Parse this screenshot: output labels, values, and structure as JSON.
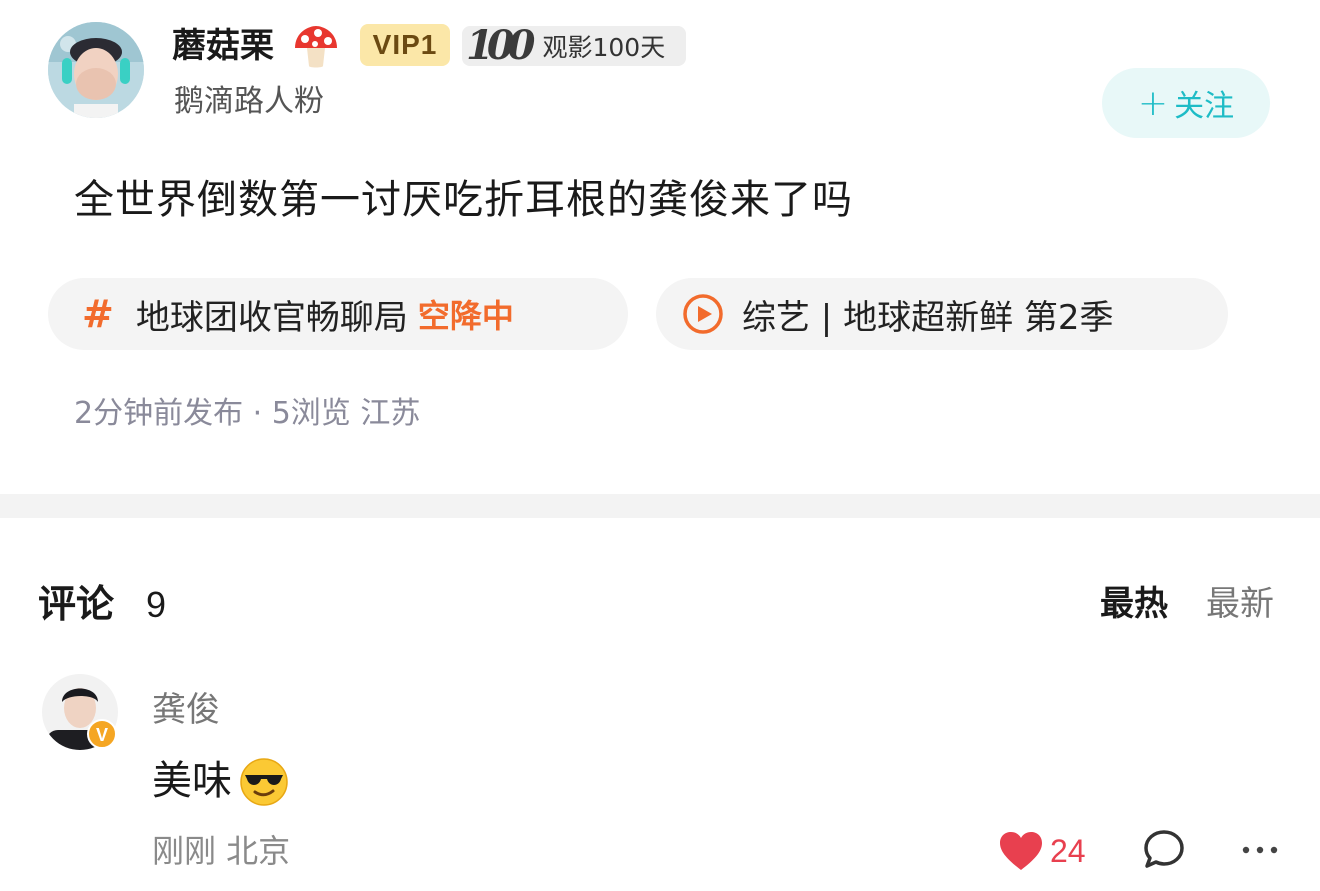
{
  "post": {
    "author": {
      "name": "蘑菇栗",
      "vip": "VIP1",
      "days_number": "100",
      "days_text": "观影100天",
      "fan_label": "鹅滴路人粉"
    },
    "follow_label": "+ 关注",
    "follow_plus": "+",
    "follow_text": "关注",
    "text": "全世界倒数第一讨厌吃折耳根的龚俊来了吗",
    "topic": {
      "icon": "hash-icon",
      "label": "地球团收官畅聊局",
      "badge": "空降中",
      "color": "#f26b2c"
    },
    "show": {
      "icon": "play-circle-icon",
      "label": "综艺 | 地球超新鲜 第2季"
    },
    "meta": "2分钟前发布 · 5浏览 江苏"
  },
  "comments": {
    "title": "评论",
    "count": "9",
    "sort_hot": "最热",
    "sort_new": "最新",
    "items": [
      {
        "name": "龚俊",
        "verified": "V",
        "text": "美味",
        "emoji": "sunglasses-face",
        "meta": "刚刚 北京",
        "likes": "24",
        "liked": true
      }
    ]
  },
  "colors": {
    "accent": "#f26b2c",
    "follow": "#1ebcc6",
    "like": "#e8404f",
    "vip_bg": "#fbe7a8"
  }
}
